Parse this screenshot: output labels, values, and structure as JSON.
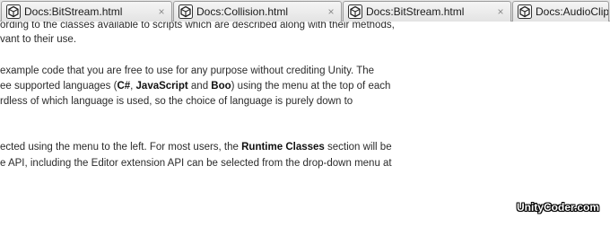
{
  "tabs": [
    {
      "title": "Docs:BitStream.html",
      "close": "×",
      "icon": "unity-logo-icon"
    },
    {
      "title": "Docs:Collision.html",
      "close": "×",
      "icon": "unity-logo-icon"
    },
    {
      "title": "Docs:BitStream.html",
      "close": "×",
      "icon": "unity-logo-icon"
    },
    {
      "title": "Docs:AudioClip.ht",
      "close": "",
      "icon": "unity-logo-icon"
    }
  ],
  "content": {
    "para1": {
      "line1": "ording to the classes available to scripts which are described along with their methods,",
      "line2": "vant to their use."
    },
    "para2": {
      "line1": "example code that you are free to use for any purpose without crediting Unity. The",
      "line2_a": "ee supported languages (",
      "line2_b1": "C#",
      "line2_c": ", ",
      "line2_b2": "JavaScript",
      "line2_d": " and ",
      "line2_b3": "Boo",
      "line2_e": ") using the menu at the top of each",
      "line3": "rdless of which language is used, so the choice of language is purely down to"
    },
    "para3": {
      "line1_a": "ected using the menu to the left. For most users, the ",
      "line1_b": "Runtime Classes",
      "line1_c": " section will be",
      "line2": "e API, including the Editor extension API can be selected from the drop-down menu at"
    }
  },
  "watermark": "UnityCoder.com"
}
